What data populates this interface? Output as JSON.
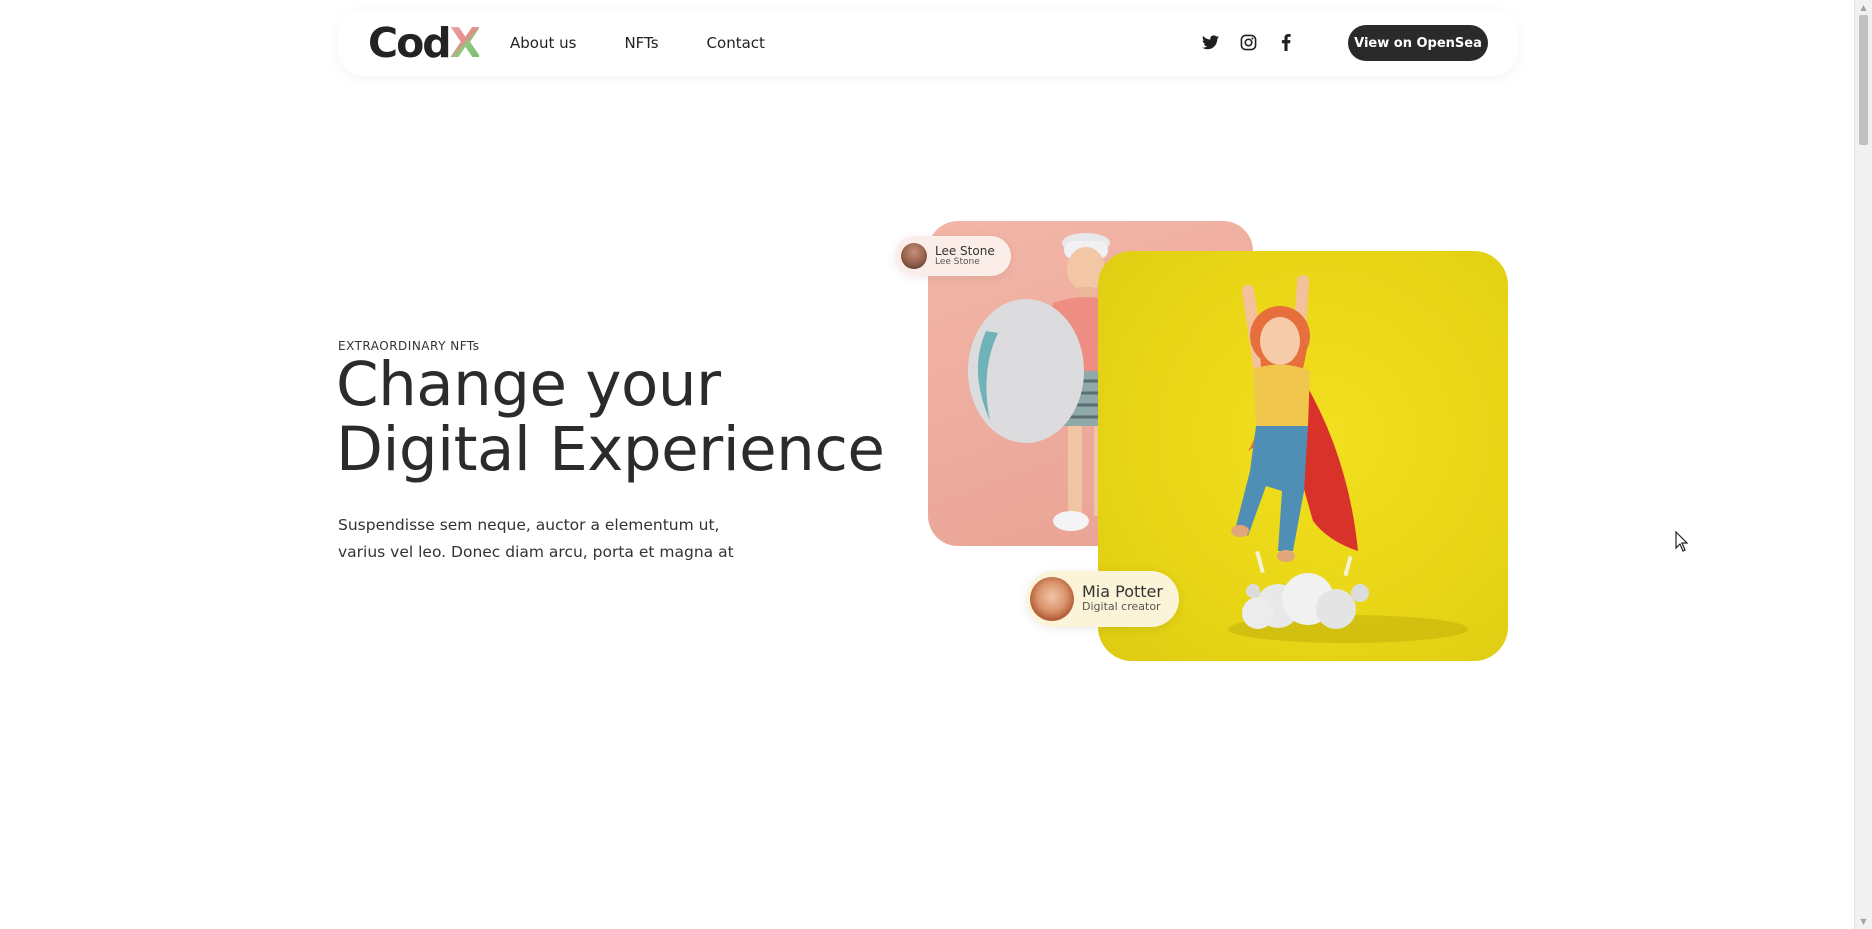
{
  "header": {
    "logo_main": "Cod",
    "logo_accent": "X",
    "nav": [
      {
        "label": "About us"
      },
      {
        "label": "NFTs"
      },
      {
        "label": "Contact"
      }
    ],
    "social_icons": [
      "twitter-icon",
      "instagram-icon",
      "facebook-icon"
    ],
    "cta_label": "View on OpenSea"
  },
  "hero": {
    "eyebrow": "EXTRAORDINARY NFTs",
    "title_line1": "Change your",
    "title_line2": "Digital Experience",
    "subtitle_line1": "Suspendisse sem neque, auctor a elementum ut,",
    "subtitle_line2": "varius vel leo. Donec diam arcu, porta et magna at"
  },
  "cards": {
    "creator1": {
      "name": "Lee Stone",
      "role": "Lee Stone"
    },
    "creator2": {
      "name": "Mia Potter",
      "role": "Digital creator"
    }
  },
  "colors": {
    "accent_dark": "#2a2a2a",
    "card_pink": "#f2b6a8",
    "card_yellow": "#e8d516"
  }
}
